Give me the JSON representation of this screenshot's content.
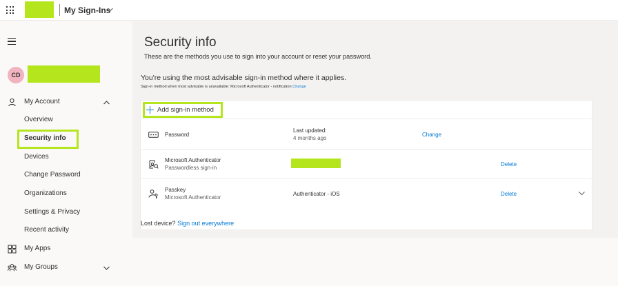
{
  "colors": {
    "accent": "#0078d4",
    "highlight": "#b5e61d",
    "avatar_bg": "#f0b3bf",
    "sidebar_bg": "#faf9f8",
    "content_bg": "#f3f2f1"
  },
  "topbar": {
    "app_title": "My Sign-Ins",
    "waffle_icon": "waffle-icon",
    "chevron_icon": "chevron-down-icon"
  },
  "sidebar": {
    "menu_icon": "hamburger-icon",
    "avatar_initials": "CD",
    "items": [
      {
        "label": "My Account",
        "icon": "person-icon",
        "expanded": true
      },
      {
        "label": "Overview"
      },
      {
        "label": "Security info",
        "selected": true
      },
      {
        "label": "Devices"
      },
      {
        "label": "Change Password"
      },
      {
        "label": "Organizations"
      },
      {
        "label": "Settings & Privacy"
      },
      {
        "label": "Recent activity"
      },
      {
        "label": "My Apps",
        "icon": "apps-icon"
      },
      {
        "label": "My Groups",
        "icon": "groups-icon",
        "expanded": false
      }
    ]
  },
  "main": {
    "title": "Security info",
    "description": "These are the methods you use to sign into your account or reset your password.",
    "advisable": "You're using the most advisable sign-in method where it applies.",
    "advisable_note": "Sign-in method when most advisable is unavailable: Microsoft Authenticator - notification",
    "advisable_change": "Change",
    "add_method_label": "Add sign-in method",
    "methods": [
      {
        "name": "Password",
        "icon": "password-icon",
        "info_label": "Last updated:",
        "info_value": "4 months ago",
        "action": "Change"
      },
      {
        "name": "Microsoft Authenticator",
        "sub": "Passwordless sign-in",
        "icon": "authenticator-icon",
        "action": "Delete"
      },
      {
        "name": "Passkey",
        "sub": "Microsoft Authenticator",
        "icon": "passkey-icon",
        "info_label": "Authenticator - iOS",
        "action": "Delete"
      }
    ],
    "lost_device": "Lost device?",
    "sign_out_everywhere": "Sign out everywhere"
  }
}
